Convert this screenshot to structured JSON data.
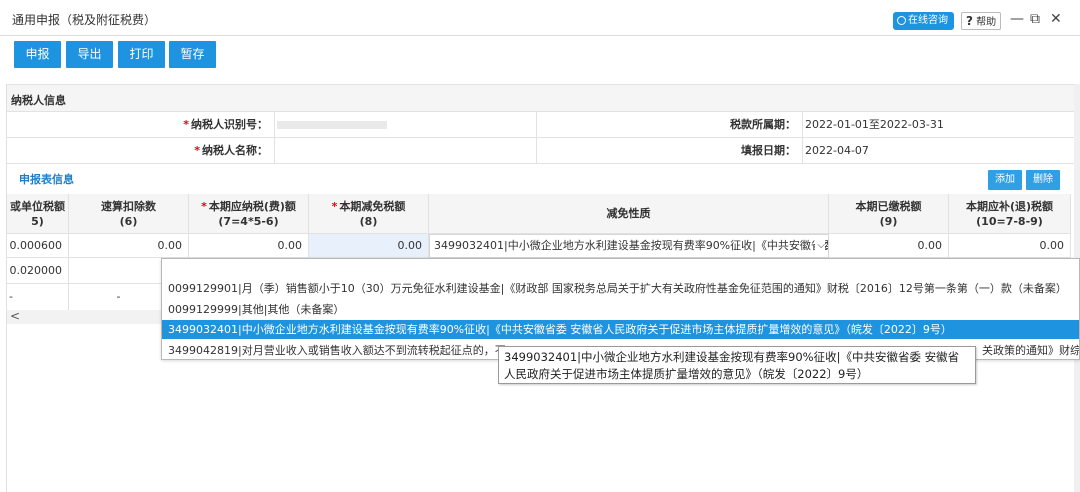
{
  "window": {
    "title": "通用申报（税及附征税费）",
    "online_consult": "在线咨询",
    "help": "帮助",
    "minimize": "—",
    "restore": "⧉",
    "close": "✕"
  },
  "toolbar": {
    "declare": "申报",
    "export": "导出",
    "print": "打印",
    "save_temp": "暂存"
  },
  "taxpayer": {
    "section_title": "纳税人信息",
    "id_label": "纳税人识别号：",
    "name_label": "纳税人名称：",
    "period_label": "税款所属期：",
    "period_value": "2022-01-01至2022-03-31",
    "fill_date_label": "填报日期：",
    "fill_date_value": "2022-04-07"
  },
  "declaration": {
    "section_title": "申报表信息",
    "add": "添加",
    "delete": "删除",
    "columns": {
      "c0_line1": "或单位税额",
      "c0_line2": "5)",
      "c1_line1": "速算扣除数",
      "c1_line2": "(6)",
      "c2_line1": "本期应纳税(费)额",
      "c2_line2": "(7=4*5-6)",
      "c3_line1": "本期减免税额",
      "c3_line2": "(8)",
      "c4": "减免性质",
      "c5_line1": "本期已缴税额",
      "c5_line2": "(9)",
      "c6_line1": "本期应补(退)税额",
      "c6_line2": "(10=7-8-9)"
    },
    "rows": [
      {
        "unit": "0.000600",
        "quick": "0.00",
        "payable": "0.00",
        "relief": "0.00",
        "nature": "3499032401|中小微企业地方水利建设基金按现有费率90%征收|《中共安徽省委",
        "paid": "0.00",
        "due": "0.00"
      },
      {
        "unit": "0.020000"
      },
      {
        "unit": "-",
        "quick": "-"
      }
    ]
  },
  "dropdown": {
    "items": [
      "0099129901|月（季）销售额小于10（30）万元免征水利建设基金|《财政部 国家税务总局关于扩大有关政府性基金免征范围的通知》财税〔2016〕12号第一条第（一）款（未备案）",
      "0099129999|其他|其他（未备案）",
      "3499032401|中小微企业地方水利建设基金按现有费率90%征收|《中共安徽省委 安徽省人民政府关于促进市场主体提质扩量增效的意见》（皖发〔2022〕9号）",
      "3499042819|对月营业收入或销售收入额达不到流转税起征点的，不"
    ],
    "item4_tail": "关政策的通知》财综"
  },
  "tooltip": {
    "line1": "3499032401|中小微企业地方水利建设基金按现有费率90%征收|《中共安徽省委 安徽省",
    "line2": "人民政府关于促进市场主体提质扩量增效的意见》（皖发〔2022〕9号）"
  },
  "scroll_left": "<"
}
